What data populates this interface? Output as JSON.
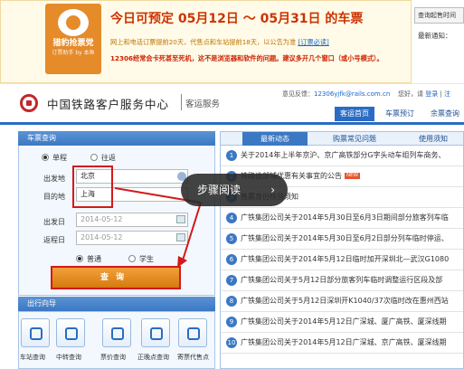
{
  "banner": {
    "logo_title": "猎豹抢票党",
    "logo_sub": "订票助手 by 本鱼",
    "title": "今日可预定 05月12日 ～ 05月31日 的车票",
    "line1_text": "网上和电话订票提前20天，代售点和车站提前18天，以公告为准 ",
    "line1_link": "[订票必读]",
    "line2": "12306经常会卡死甚至死机，这不是浏览器和软件的问题。建议多开几个窗口（或小号模式）。"
  },
  "side": {
    "notice_button": "查询起售时间",
    "notice_label": "最新通知："
  },
  "header": {
    "site_name": "中国铁路客户服务中心",
    "site_sub": "客运服务",
    "feedback_label": "意见反馈：",
    "feedback_email": "12306yjfk@rails.com.cn",
    "greeting": "您好，请",
    "login": "登录",
    "register": "注"
  },
  "nav": {
    "tabs": [
      "客运首页",
      "车票预订",
      "余票查询"
    ]
  },
  "query": {
    "title": "车票查询",
    "trip_single": "单程",
    "trip_return": "往返",
    "from_label": "出发地",
    "from_value": "北京",
    "to_label": "目的地",
    "to_value": "上海",
    "depart_label": "出发日",
    "depart_value": "2014-05-12",
    "return_label": "返程日",
    "return_value": "2014-05-12",
    "ticket_normal": "普通",
    "ticket_student": "学生",
    "search_button": "查询"
  },
  "guide": {
    "title": "出行向导",
    "items": [
      "车站查询",
      "中转查询",
      "票价查询",
      "正晚点查询",
      "寄票代售点"
    ]
  },
  "news": {
    "tabs": [
      "最新动态",
      "购票常见问题",
      "使用须知"
    ],
    "items": [
      "关于2014年上半年京沪、京广高铁部分G字头动车组列车商务、",
      "铁路途部铺优惠有关事宜的公告",
      "售票身份核验须知",
      "广铁集团公司关于2014年5月30日至6月3日期间部分旅客列车临",
      "广铁集团公司关于2014年5月30日至6月2日部分列车临时停运、",
      "广铁集团公司关于2014年5月12日临时加开深圳北—武汉G1080",
      "广铁集团公司关于5月12日部分旅客列车临时调整运行区段及部",
      "广铁集团公司关于5月12日深圳开K1040/37次临时改在惠州西站",
      "广铁集团公司关于2014年5月12日广深城、厦广高铁、厦深线期",
      "广铁集团公司关于2014年5月12日广深城、京广高铁、厦深线期"
    ],
    "new_badge": "NEW",
    "numbers": [
      "1",
      "2",
      "3",
      "4",
      "5",
      "6",
      "7",
      "8",
      "9",
      "10"
    ]
  },
  "overlay": {
    "label": "步骤阅读",
    "chevron": "›"
  },
  "colors": {
    "accent_blue": "#2a6cc4",
    "highlight_red": "#d21a1a",
    "search_orange": "#e38a1e"
  }
}
